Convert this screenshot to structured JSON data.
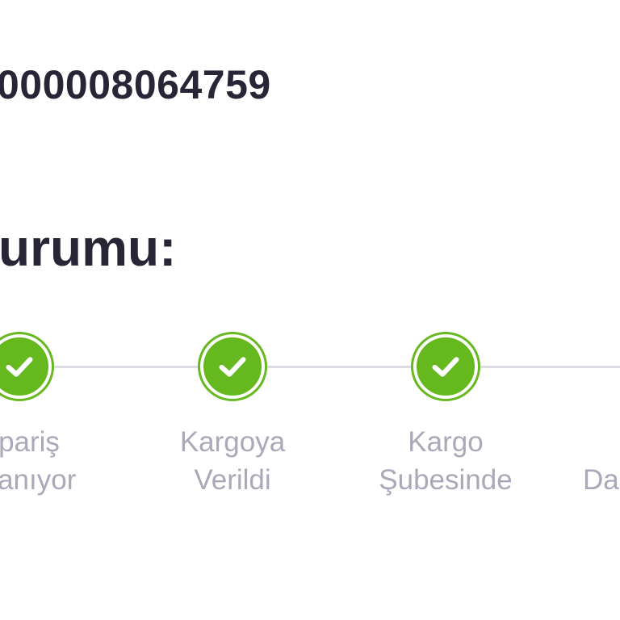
{
  "order": {
    "number": "000008064759"
  },
  "status": {
    "title": "urumu:"
  },
  "steps": [
    {
      "line1": "pariş",
      "line2": "rlanıyor",
      "state": "done",
      "icon": "check-icon"
    },
    {
      "line1": "Kargoya",
      "line2": "Verildi",
      "state": "done",
      "icon": "check-icon"
    },
    {
      "line1": "Kargo",
      "line2": "Şubesinde",
      "state": "done",
      "icon": "check-icon"
    },
    {
      "line1": "",
      "line2": "Da",
      "state": "pending"
    }
  ],
  "colors": {
    "accent": "#66b81f",
    "title_text": "#262637",
    "label_text": "#a9a9b9",
    "track": "#dcdce2"
  }
}
